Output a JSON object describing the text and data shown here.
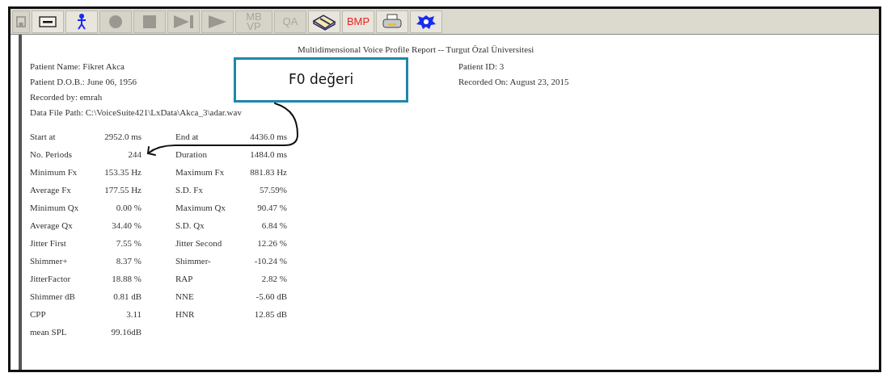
{
  "toolbar": [
    {
      "kind": "save",
      "disabled": true
    },
    {
      "kind": "dash",
      "disabled": false
    },
    {
      "kind": "figure",
      "disabled": false
    },
    {
      "kind": "record",
      "disabled": true
    },
    {
      "kind": "stop",
      "disabled": true
    },
    {
      "kind": "step",
      "disabled": true
    },
    {
      "kind": "play",
      "disabled": true
    },
    {
      "kind": "text",
      "label": "MB VP",
      "disabled": true
    },
    {
      "kind": "text",
      "label": "QA",
      "disabled": true
    },
    {
      "kind": "notepad",
      "disabled": false
    },
    {
      "kind": "text",
      "label": "BMP",
      "disabled": false
    },
    {
      "kind": "printer",
      "disabled": false
    },
    {
      "kind": "blob",
      "disabled": false
    }
  ],
  "report": {
    "title": "Multidimensional Voice Profile Report -- Turgut Özal Üniversitesi",
    "info_left": [
      "Patient Name: Fikret Akca",
      "Patient D.O.B.: June 06, 1956",
      "Recorded by: emrah",
      "Data File Path: C:\\VoiceSuite421\\LxData\\Akca_3\\adar.wav"
    ],
    "info_right": [
      "Patient ID: 3",
      "Recorded On: August 23, 2015"
    ],
    "stats": [
      [
        {
          "label": "Start at",
          "value": "2952.0 ms"
        },
        {
          "label": "End at",
          "value": "4436.0 ms"
        }
      ],
      [
        {
          "label": "No. Periods",
          "value": "244"
        },
        {
          "label": "Duration",
          "value": "1484.0 ms"
        }
      ],
      [
        {
          "label": "Minimum Fx",
          "value": "153.35 Hz"
        },
        {
          "label": "Maximum Fx",
          "value": "881.83 Hz"
        }
      ],
      [
        {
          "label": "Average Fx",
          "value": "177.55 Hz"
        },
        {
          "label": "S.D. Fx",
          "value": "57.59%"
        }
      ],
      [
        {
          "label": "Minimum Qx",
          "value": "0.00 %"
        },
        {
          "label": "Maximum Qx",
          "value": "90.47 %"
        }
      ],
      [
        {
          "label": "Average Qx",
          "value": "34.40 %"
        },
        {
          "label": "S.D. Qx",
          "value": "6.84 %"
        }
      ],
      [
        {
          "label": "Jitter First",
          "value": "7.55 %"
        },
        {
          "label": "Jitter Second",
          "value": "12.26 %"
        }
      ],
      [
        {
          "label": "Shimmer+",
          "value": "8.37 %"
        },
        {
          "label": "Shimmer-",
          "value": "-10.24 %"
        }
      ],
      [
        {
          "label": "JitterFactor",
          "value": "18.88 %"
        },
        {
          "label": "RAP",
          "value": "2.82 %"
        }
      ],
      [
        {
          "label": "Shimmer dB",
          "value": "0.81 dB"
        },
        {
          "label": "NNE",
          "value": "-5.60 dB"
        }
      ],
      [
        {
          "label": "CPP",
          "value": "3.11"
        },
        {
          "label": "HNR",
          "value": "12.85 dB"
        }
      ],
      [
        {
          "label": "mean SPL",
          "value": "99.16dB"
        }
      ]
    ]
  },
  "callout": {
    "text": "F0 değeri"
  }
}
